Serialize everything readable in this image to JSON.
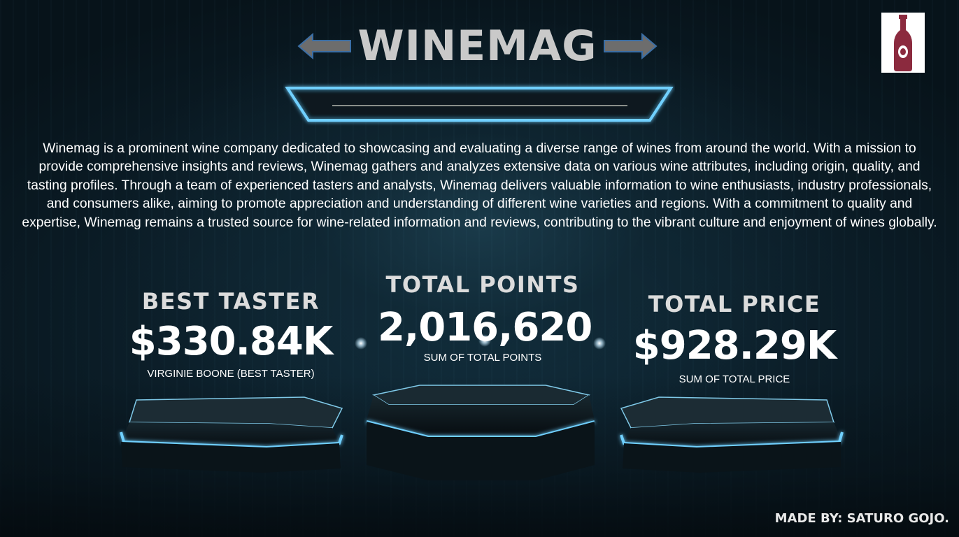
{
  "header": {
    "title": "WINEMAG"
  },
  "icons": {
    "left_arrow": "arrow-left-icon",
    "right_arrow": "arrow-right-icon",
    "logo": "wine-bottle-icon"
  },
  "colors": {
    "title": "#c9c9c9",
    "arrow_fill": "#6d6d6d",
    "arrow_stroke": "#3b6ea5",
    "neon": "#6fd0ff",
    "logo_bottle": "#8b2a3e"
  },
  "description": "Winemag is a prominent wine company dedicated to showcasing and evaluating a diverse range of wines from around the world. With a mission to provide comprehensive insights and reviews, Winemag gathers and analyzes extensive data on various wine attributes, including origin, quality, and tasting profiles. Through a team of experienced tasters and analysts, Winemag delivers valuable information to wine enthusiasts, industry professionals, and consumers alike, aiming to promote appreciation and understanding of different wine varieties and regions. With a commitment to quality and expertise, Winemag remains a trusted source for wine-related information and reviews, contributing to the vibrant culture and enjoyment of wines globally.",
  "kpis": {
    "best_taster": {
      "heading": "BEST TASTER",
      "value": "$330.84K",
      "caption": "VIRGINIE BOONE (BEST TASTER)"
    },
    "total_points": {
      "heading": "TOTAL POINTS",
      "value": "2,016,620",
      "caption": "SUM OF TOTAL POINTS"
    },
    "total_price": {
      "heading": "TOTAL PRICE",
      "value": "$928.29K",
      "caption": "SUM OF TOTAL PRICE"
    }
  },
  "footer": {
    "credit": "MADE BY: SATURO GOJO."
  }
}
